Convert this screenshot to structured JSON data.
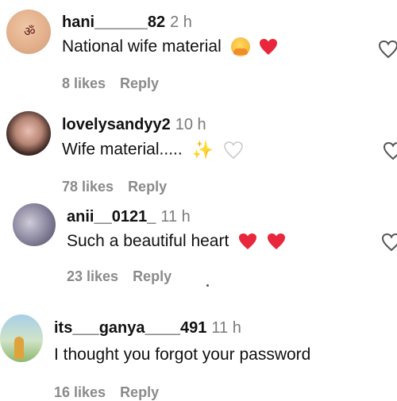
{
  "comments": [
    {
      "username": "hani______82",
      "time": "2 h",
      "text": "National wife material",
      "emojis": [
        "hugging-face-emoji",
        "red-heart-emoji"
      ],
      "likes": "8 likes",
      "reply": "Reply"
    },
    {
      "username": "lovelysandyy2",
      "time": "10 h",
      "text": "Wife material.....",
      "emojis": [
        "sparkles-emoji",
        "white-heart-emoji"
      ],
      "likes": "78 likes",
      "reply": "Reply"
    },
    {
      "username": "anii__0121_",
      "time": "11 h",
      "text": "Such a beautiful heart",
      "emojis": [
        "red-heart-emoji",
        "red-heart-emoji"
      ],
      "likes": "23 likes",
      "reply": "Reply"
    },
    {
      "username": "its___ganya____491",
      "time": "11 h",
      "text": "I thought you forgot your password",
      "emojis": [],
      "likes": "16 likes",
      "reply": "Reply"
    }
  ],
  "colors": {
    "text": "#111111",
    "muted": "#8a8a8a",
    "heart": "#e8263c"
  },
  "icons": {
    "like": "heart-outline-icon"
  }
}
